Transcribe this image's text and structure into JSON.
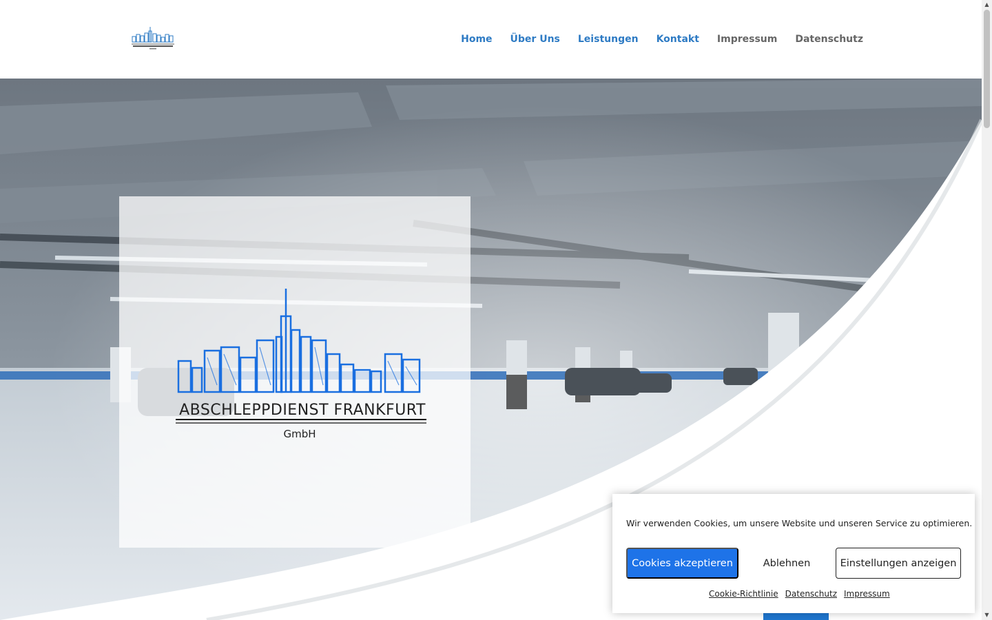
{
  "colors": {
    "accent": "#2e7bc4",
    "accent_button": "#1e73e8",
    "nav_plain": "#666666"
  },
  "header": {
    "logo_icon": "skyline-logo-icon",
    "nav": [
      {
        "label": "Home",
        "active": true
      },
      {
        "label": "Über Uns",
        "active": true
      },
      {
        "label": "Leistungen",
        "active": true
      },
      {
        "label": "Kontakt",
        "active": true
      },
      {
        "label": "Impressum",
        "active": false
      },
      {
        "label": "Datenschutz",
        "active": false
      }
    ]
  },
  "hero": {
    "logo_title": "ABSCHLEPPDIENST FRANKFURT",
    "logo_subtitle": "GmbH"
  },
  "cookie_banner": {
    "message": "Wir verwenden Cookies, um unsere Website und unseren Service zu optimieren.",
    "accept_label": "Cookies akzeptieren",
    "deny_label": "Ablehnen",
    "settings_label": "Einstellungen anzeigen",
    "links": [
      "Cookie-Richtlinie",
      "Datenschutz",
      "Impressum"
    ]
  }
}
